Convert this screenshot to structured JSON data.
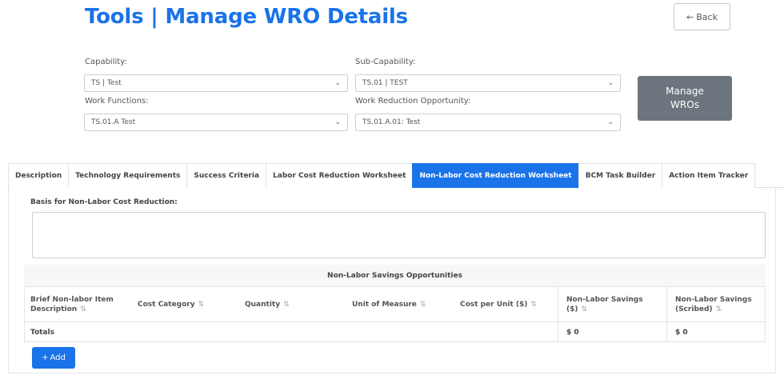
{
  "header": {
    "title": "Tools | Manage WRO Details",
    "back_label": "Back",
    "back_icon": "arrow-left-icon"
  },
  "filters": {
    "capability_label": "Capability:",
    "capability_value": "TS | Test",
    "sub_capability_label": "Sub-Capability:",
    "sub_capability_value": "TS.01 | TEST",
    "work_functions_label": "Work Functions:",
    "work_functions_value": "TS.01.A Test",
    "wro_label": "Work Reduction Opportunity:",
    "wro_value": "TS.01.A.01: Test"
  },
  "manage_button": {
    "line1": "Manage",
    "line2": "WROs"
  },
  "tabs": [
    {
      "label": "Description",
      "active": false
    },
    {
      "label": "Technology Requirements",
      "active": false
    },
    {
      "label": "Success Criteria",
      "active": false
    },
    {
      "label": "Labor Cost Reduction Worksheet",
      "active": false
    },
    {
      "label": "Non-Labor Cost Reduction Worksheet",
      "active": true
    },
    {
      "label": "BCM Task Builder",
      "active": false
    },
    {
      "label": "Action Item Tracker",
      "active": false
    }
  ],
  "basis": {
    "label": "Basis for Non-Labor Cost Reduction:",
    "value": ""
  },
  "savings_table": {
    "title": "Non-Labor Savings Opportunities",
    "columns": [
      "Brief Non-labor Item Description",
      "Cost Category",
      "Quantity",
      "Unit of Measure",
      "Cost per Unit ($)",
      "Non-Labor Savings ($)",
      "Non-Labor Savings (Scribed)"
    ],
    "totals_label": "Totals",
    "totals_savings": "$ 0",
    "totals_scribed": "$ 0"
  },
  "add_button": {
    "label": "Add",
    "icon": "plus-icon"
  },
  "colors": {
    "accent": "#1a73e8",
    "manage_button": "#6c757d"
  }
}
